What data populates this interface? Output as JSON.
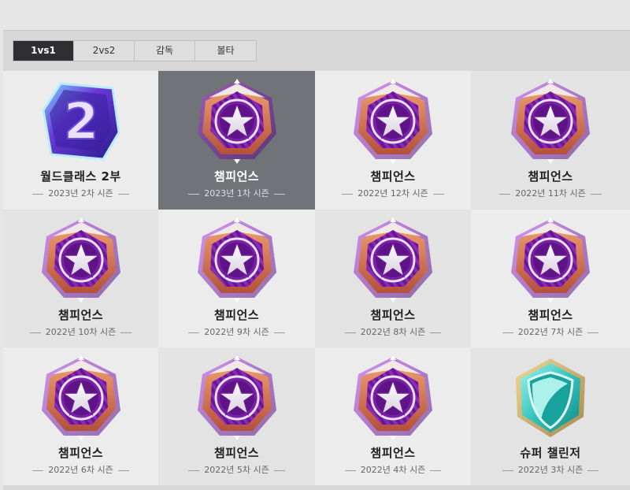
{
  "tabs": [
    {
      "label": "1vs1",
      "active": true
    },
    {
      "label": "2vs2",
      "active": false
    },
    {
      "label": "감독",
      "active": false
    },
    {
      "label": "볼타",
      "active": false
    }
  ],
  "rewards": [
    {
      "title": "월드클래스 2부",
      "season": "2023년 2차 시즌",
      "icon": "world-class-2-badge-icon"
    },
    {
      "title": "챔피언스",
      "season": "2023년 1차 시즌",
      "icon": "champions-star-badge-icon",
      "selected": true
    },
    {
      "title": "챔피언스",
      "season": "2022년 12차 시즌",
      "icon": "champions-star-badge-icon"
    },
    {
      "title": "챔피언스",
      "season": "2022년 11차 시즌",
      "icon": "champions-star-badge-icon"
    },
    {
      "title": "챔피언스",
      "season": "2022년 10차 시즌",
      "icon": "champions-star-badge-icon"
    },
    {
      "title": "챔피언스",
      "season": "2022년 9차 시즌",
      "icon": "champions-star-badge-icon"
    },
    {
      "title": "챔피언스",
      "season": "2022년 8차 시즌",
      "icon": "champions-star-badge-icon"
    },
    {
      "title": "챔피언스",
      "season": "2022년 7차 시즌",
      "icon": "champions-star-badge-icon"
    },
    {
      "title": "챔피언스",
      "season": "2022년 6차 시즌",
      "icon": "champions-star-badge-icon"
    },
    {
      "title": "챔피언스",
      "season": "2022년 5차 시즌",
      "icon": "champions-star-badge-icon"
    },
    {
      "title": "챔피언스",
      "season": "2022년 4차 시즌",
      "icon": "champions-star-badge-icon"
    },
    {
      "title": "슈퍼 챌린저",
      "season": "2022년 3차 시즌",
      "icon": "super-challenger-shield-badge-icon"
    }
  ],
  "colors": {
    "selected_bg": "#707378",
    "tab_active_bg": "#2f2f31",
    "champions_purple": "#8a2bb8",
    "champions_orange": "#d9774a",
    "challenger_teal": "#3fc8c0"
  }
}
